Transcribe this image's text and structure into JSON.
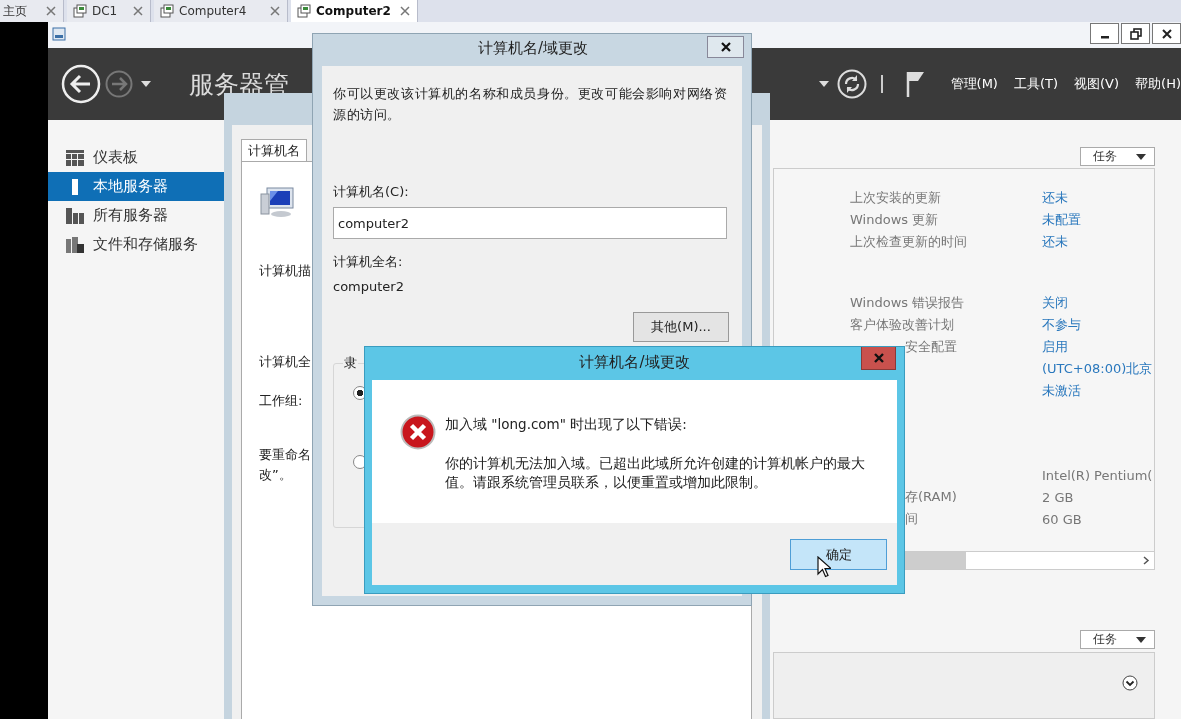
{
  "vm_tabs": [
    {
      "label": "主页",
      "kind": "home",
      "selected": false
    },
    {
      "label": "DC1",
      "kind": "vm",
      "selected": false
    },
    {
      "label": "Computer4",
      "kind": "vm",
      "selected": false
    },
    {
      "label": "Computer2",
      "kind": "vm",
      "selected": true
    }
  ],
  "header": {
    "title": "服务器管",
    "menus": [
      "管理(M)",
      "工具(T)",
      "视图(V)",
      "帮助(H)"
    ]
  },
  "nav": [
    {
      "label": "仪表板",
      "kind": "dashboard",
      "selected": false
    },
    {
      "label": "本地服务器",
      "kind": "local",
      "selected": true
    },
    {
      "label": "所有服务器",
      "kind": "servers",
      "selected": false
    },
    {
      "label": "文件和存储服务",
      "kind": "storage",
      "selected": false
    }
  ],
  "properties": {
    "tasks": "任务",
    "groups": [
      [
        {
          "label": "上次安装的更新",
          "label_clipped": false,
          "value": "还未",
          "link": true
        },
        {
          "label": "Windows 更新",
          "label_clipped": false,
          "value": "未配置",
          "link": true
        },
        {
          "label": "上次检查更新的时间",
          "label_clipped": false,
          "value": "还未",
          "link": true
        }
      ],
      [
        {
          "label": "Windows 错误报告",
          "label_clipped": false,
          "value": "关闭",
          "link": true
        },
        {
          "label": "客户体验改善计划",
          "label_clipped": false,
          "value": "不参与",
          "link": true
        },
        {
          "label": "安全配置",
          "label_clipped": true,
          "value": "启用",
          "link": true
        },
        {
          "value": "(UTC+08:00)北京",
          "link": true
        },
        {
          "value": "未激活",
          "link": true
        }
      ],
      [
        {
          "value": "Intel(R) Pentium(",
          "link": false
        },
        {
          "label": "存(RAM)",
          "label_clipped": true,
          "value": "2 GB",
          "link": false
        },
        {
          "label": "间",
          "label_clipped": true,
          "value": "60 GB",
          "link": false
        }
      ]
    ]
  },
  "events": {
    "tasks": "任务"
  },
  "system_properties_dialog": {
    "tab": "计算机名",
    "labels": [
      "计算机描",
      "计算机全",
      "工作组:",
      "要重命名改”。"
    ]
  },
  "rename_dialog": {
    "title": "计算机名/域更改",
    "description": "你可以更改该计算机的名称和成员身份。更改可能会影响对网络资源的访问。",
    "name_label": "计算机名(C):",
    "name_value": "computer2",
    "full_name_label": "计算机全名:",
    "full_name": "computer2",
    "more_button": "其他(M)...",
    "member_of_legend": "隶",
    "member_of": [
      {
        "selected": true
      },
      {
        "selected": false
      }
    ]
  },
  "error_dialog": {
    "title": "计算机名/域更改",
    "heading": "加入域 \"long.com\" 时出现了以下错误:",
    "message": "你的计算机无法加入域。已超出此域所允许创建的计算机帐户的最大值。请跟系统管理员联系，以便重置或增加此限制。",
    "ok_button": "确定"
  }
}
